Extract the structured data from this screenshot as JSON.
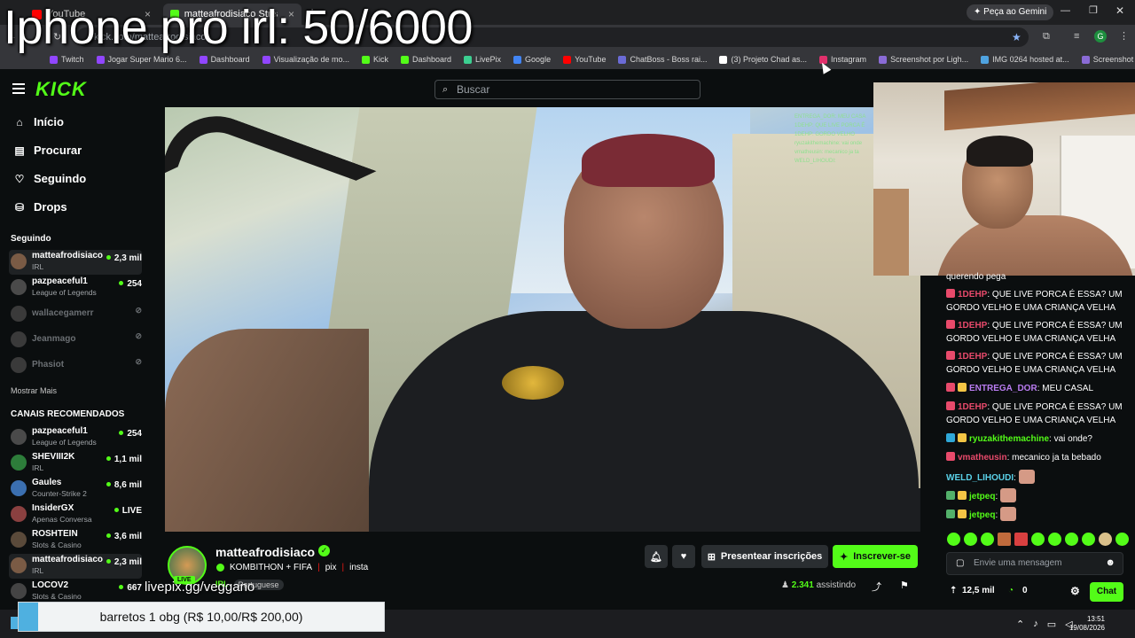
{
  "browser": {
    "tabs": [
      {
        "label": "YouTube",
        "color": "#ff0000"
      },
      {
        "label": "matteafrodisiaco Stream",
        "color": "#53fc18"
      }
    ],
    "url": "kick.com/matteafrodisiaco",
    "gemini_label": "Peça ao Gemini",
    "bookmarks": [
      {
        "label": "Twitch",
        "color": "#9146ff"
      },
      {
        "label": "Jogar Super Mario 6...",
        "color": "#9146ff"
      },
      {
        "label": "Dashboard",
        "color": "#9146ff"
      },
      {
        "label": "Visualização de mo...",
        "color": "#9146ff"
      },
      {
        "label": "Kick",
        "color": "#53fc18"
      },
      {
        "label": "Dashboard",
        "color": "#53fc18"
      },
      {
        "label": "LivePix",
        "color": "#3ccf91"
      },
      {
        "label": "Google",
        "color": "#4285f4"
      },
      {
        "label": "YouTube",
        "color": "#ff0000"
      },
      {
        "label": "ChatBoss - Boss rai...",
        "color": "#6b6bd6"
      },
      {
        "label": "(3) Projeto Chad as...",
        "color": "#ffffff"
      },
      {
        "label": "Instagram",
        "color": "#e1306c"
      },
      {
        "label": "Screenshot por Ligh...",
        "color": "#8a6bd6"
      },
      {
        "label": "IMG 0264 hosted at...",
        "color": "#4fa3e0"
      },
      {
        "label": "Screenshot por Ligh...",
        "color": "#8a6bd6"
      }
    ]
  },
  "overlay_title": "Iphone pro irl: 50/6000",
  "header": {
    "logo": "KICK",
    "search_placeholder": "Buscar"
  },
  "sidebar": {
    "nav": [
      {
        "label": "Início",
        "icon": "home-icon"
      },
      {
        "label": "Procurar",
        "icon": "browse-icon"
      },
      {
        "label": "Seguindo",
        "icon": "heart-icon"
      },
      {
        "label": "Drops",
        "icon": "drops-icon"
      }
    ],
    "following_title": "Seguindo",
    "following": [
      {
        "name": "matteafrodisiaco",
        "category": "IRL",
        "viewers": "2,3 mil",
        "online": true
      },
      {
        "name": "pazpeaceful1",
        "category": "League of Legends",
        "viewers": "254",
        "online": true
      },
      {
        "name": "wallacegamerr",
        "category": "",
        "viewers": "",
        "online": false
      },
      {
        "name": "Jeanmago",
        "category": "",
        "viewers": "",
        "online": false
      },
      {
        "name": "Phasiot",
        "category": "",
        "viewers": "",
        "online": false
      }
    ],
    "show_more": "Mostrar Mais",
    "recommended_title": "CANAIS RECOMENDADOS",
    "recommended": [
      {
        "name": "pazpeaceful1",
        "category": "League of Legends",
        "viewers": "254"
      },
      {
        "name": "SHEVIII2K",
        "category": "IRL",
        "viewers": "1,1 mil"
      },
      {
        "name": "Gaules",
        "category": "Counter-Strike 2",
        "viewers": "8,6 mil"
      },
      {
        "name": "InsiderGX",
        "category": "Apenas Conversa",
        "viewers": "LIVE"
      },
      {
        "name": "ROSHTEIN",
        "category": "Slots & Casino",
        "viewers": "3,6 mil"
      },
      {
        "name": "matteafrodisiaco",
        "category": "IRL",
        "viewers": "2,3 mil"
      },
      {
        "name": "LOCOV2",
        "category": "Slots & Casino",
        "viewers": "667"
      }
    ]
  },
  "video_chat_overlay": [
    "ENTREGA_DOR: MEU CASA",
    "1DEHP: QUE LIVE PORCA É",
    "1DEHP: GORDO VELHO",
    "ryuzakithemachine: vai onde",
    "vmatheusin: mecanico ja ta",
    "WELD_LIHOUDI:"
  ],
  "stream": {
    "streamer": "matteafrodisiaco",
    "live_label": "LIVE",
    "title_parts": [
      "KOMBITHON + FIFA",
      "pix",
      "insta"
    ],
    "category": "IRL",
    "language": "Portuguese",
    "overlay_livepix": "livepix.gg/veggano",
    "buttons": {
      "gift": "Presentear inscrições",
      "subscribe": "Inscrever-se"
    },
    "viewers_count": "2.341",
    "viewers_label": "assistindo"
  },
  "chat": {
    "messages": [
      {
        "user": "",
        "text": "querendo pega",
        "color": "#ffffff"
      },
      {
        "user": "1DEHP",
        "text": "QUE LIVE PORCA É ESSA? UM GORDO VELHO E UMA CRIANÇA VELHA",
        "color": "#e84a6b"
      },
      {
        "user": "1DEHP",
        "text": "QUE LIVE PORCA É ESSA? UM GORDO VELHO E UMA CRIANÇA VELHA",
        "color": "#e84a6b"
      },
      {
        "user": "1DEHP",
        "text": "QUE LIVE PORCA É ESSA? UM GORDO VELHO E UMA CRIANÇA VELHA",
        "color": "#e84a6b"
      },
      {
        "user": "ENTREGA_DOR",
        "text": "MEU CASAL",
        "color": "#b97cf0"
      },
      {
        "user": "1DEHP",
        "text": "QUE LIVE PORCA É ESSA? UM GORDO VELHO E UMA CRIANÇA VELHA",
        "color": "#e84a6b"
      },
      {
        "user": "ryuzakithemachine",
        "text": "vai onde?",
        "color": "#53fc18"
      },
      {
        "user": "vmatheusin",
        "text": "mecanico ja ta bebado",
        "color": "#e84a6b"
      },
      {
        "user": "WELD_LIHOUDI",
        "text": "",
        "color": "#5ad1e8"
      },
      {
        "user": "jetpeq",
        "text": "",
        "color": "#53fc18"
      },
      {
        "user": "jetpeq",
        "text": "",
        "color": "#53fc18"
      }
    ],
    "input_placeholder": "Envie uma mensagem",
    "kicks": "12,5 mil",
    "points": "0",
    "send_label": "Chat"
  },
  "donation": "barretos 1 obg (R$ 10,00/R$ 200,00)",
  "tray": {
    "time": "13:51",
    "date": "19/08/2026"
  }
}
